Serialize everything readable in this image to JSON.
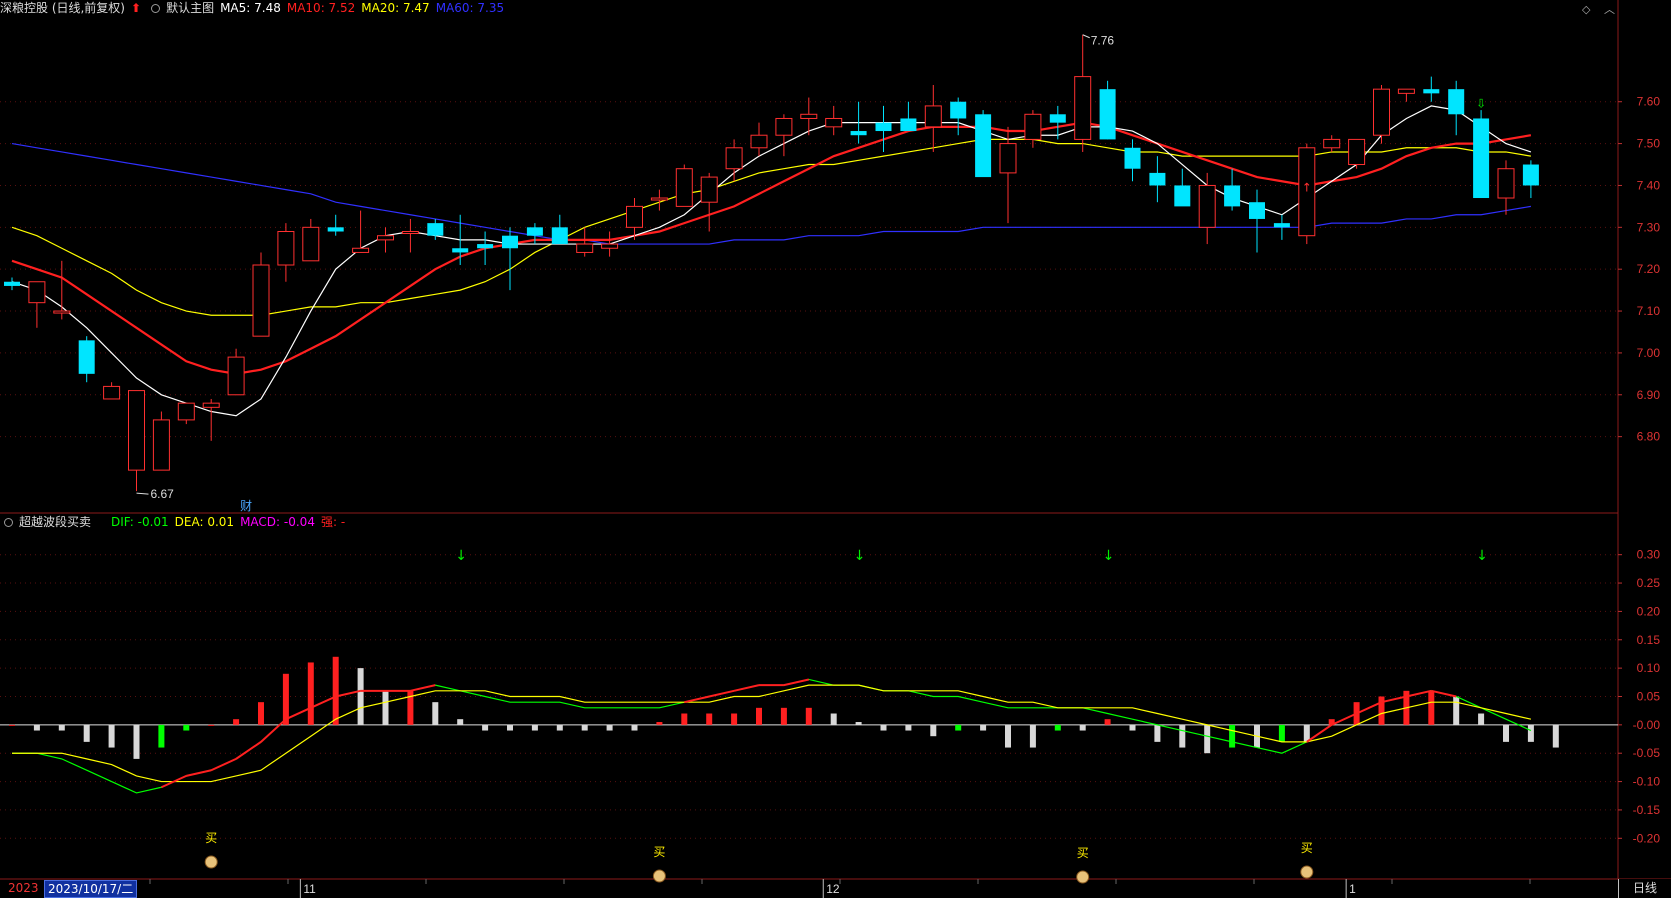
{
  "header": {
    "stock_title": "深粮控股 (日线,前复权)",
    "main_chart_label": "默认主图",
    "ma5": "MA5: 7.48",
    "ma10": "MA10: 7.52",
    "ma20": "MA20: 7.47",
    "ma60": "MA60: 7.35",
    "colors": {
      "ma5": "#ffffff",
      "ma10": "#ff2020",
      "ma20": "#ffff00",
      "ma60": "#3030ff"
    }
  },
  "indicator_header": {
    "name": "超越波段买卖",
    "dif": "DIF: -0.01",
    "dea": "DEA: 0.01",
    "macd": "MACD: -0.04",
    "extra": "强: -",
    "colors": {
      "dif": "#00ff00",
      "dea": "#ffff00",
      "macd": "#ff00ff",
      "extra": "#ff2020"
    }
  },
  "annotations": {
    "high_label": "7.76",
    "low_label": "6.67",
    "finance_marker": "财",
    "buy_label": "买"
  },
  "axis": {
    "price_ticks": [
      "7.60",
      "7.50",
      "7.40",
      "7.30",
      "7.20",
      "7.10",
      "7.00",
      "6.90",
      "6.80"
    ],
    "macd_ticks": [
      "0.30",
      "0.25",
      "0.20",
      "0.15",
      "0.10",
      "0.05",
      "-0.00",
      "-0.05",
      "-0.10",
      "-0.15",
      "-0.20"
    ],
    "month_labels": [
      "11",
      "12",
      "1"
    ]
  },
  "status": {
    "year_prefix": "2023",
    "cursor_date": "2023/10/17/二",
    "period_label": "日线"
  },
  "chart_data": {
    "type": "candlestick",
    "price_range": [
      6.62,
      7.8
    ],
    "macd_range": [
      -0.27,
      0.34
    ],
    "candles": [
      [
        7.17,
        7.18,
        7.15,
        7.16
      ],
      [
        7.12,
        7.17,
        7.06,
        7.17
      ],
      [
        7.1,
        7.22,
        7.08,
        7.1
      ],
      [
        7.03,
        7.04,
        6.93,
        6.95
      ],
      [
        6.89,
        6.93,
        6.89,
        6.92
      ],
      [
        6.72,
        6.91,
        6.67,
        6.91
      ],
      [
        6.72,
        6.86,
        6.72,
        6.84
      ],
      [
        6.84,
        6.87,
        6.83,
        6.88
      ],
      [
        6.87,
        6.89,
        6.79,
        6.88
      ],
      [
        6.9,
        7.01,
        6.9,
        6.99
      ],
      [
        7.04,
        7.24,
        7.04,
        7.21
      ],
      [
        7.21,
        7.31,
        7.17,
        7.29
      ],
      [
        7.22,
        7.32,
        7.22,
        7.3
      ],
      [
        7.3,
        7.33,
        7.28,
        7.29
      ],
      [
        7.24,
        7.34,
        7.24,
        7.25
      ],
      [
        7.27,
        7.3,
        7.24,
        7.28
      ],
      [
        7.29,
        7.32,
        7.24,
        7.29
      ],
      [
        7.31,
        7.32,
        7.27,
        7.28
      ],
      [
        7.25,
        7.33,
        7.21,
        7.24
      ],
      [
        7.26,
        7.29,
        7.21,
        7.25
      ],
      [
        7.28,
        7.3,
        7.15,
        7.25
      ],
      [
        7.3,
        7.31,
        7.26,
        7.28
      ],
      [
        7.3,
        7.33,
        7.28,
        7.26
      ],
      [
        7.24,
        7.3,
        7.23,
        7.26
      ],
      [
        7.25,
        7.29,
        7.23,
        7.26
      ],
      [
        7.3,
        7.37,
        7.27,
        7.35
      ],
      [
        7.37,
        7.39,
        7.34,
        7.37
      ],
      [
        7.35,
        7.45,
        7.35,
        7.44
      ],
      [
        7.36,
        7.43,
        7.29,
        7.42
      ],
      [
        7.44,
        7.51,
        7.41,
        7.49
      ],
      [
        7.49,
        7.55,
        7.47,
        7.52
      ],
      [
        7.52,
        7.57,
        7.47,
        7.56
      ],
      [
        7.56,
        7.61,
        7.52,
        7.57
      ],
      [
        7.54,
        7.59,
        7.52,
        7.56
      ],
      [
        7.53,
        7.6,
        7.5,
        7.52
      ],
      [
        7.55,
        7.59,
        7.48,
        7.53
      ],
      [
        7.56,
        7.6,
        7.53,
        7.53
      ],
      [
        7.54,
        7.64,
        7.48,
        7.59
      ],
      [
        7.6,
        7.61,
        7.52,
        7.56
      ],
      [
        7.57,
        7.58,
        7.43,
        7.42
      ],
      [
        7.43,
        7.54,
        7.31,
        7.5
      ],
      [
        7.51,
        7.58,
        7.49,
        7.57
      ],
      [
        7.57,
        7.59,
        7.51,
        7.55
      ],
      [
        7.51,
        7.76,
        7.48,
        7.66
      ],
      [
        7.63,
        7.65,
        7.51,
        7.51
      ],
      [
        7.49,
        7.51,
        7.41,
        7.44
      ],
      [
        7.43,
        7.47,
        7.36,
        7.4
      ],
      [
        7.4,
        7.44,
        7.38,
        7.35
      ],
      [
        7.3,
        7.43,
        7.26,
        7.4
      ],
      [
        7.4,
        7.44,
        7.34,
        7.35
      ],
      [
        7.36,
        7.39,
        7.24,
        7.32
      ],
      [
        7.31,
        7.33,
        7.27,
        7.3
      ],
      [
        7.28,
        7.5,
        7.26,
        7.49
      ],
      [
        7.49,
        7.52,
        7.48,
        7.51
      ],
      [
        7.45,
        7.51,
        7.44,
        7.51
      ],
      [
        7.52,
        7.64,
        7.5,
        7.63
      ],
      [
        7.62,
        7.63,
        7.6,
        7.63
      ],
      [
        7.63,
        7.66,
        7.6,
        7.62
      ],
      [
        7.63,
        7.65,
        7.52,
        7.57
      ],
      [
        7.56,
        7.58,
        7.37,
        7.37
      ],
      [
        7.37,
        7.46,
        7.33,
        7.44
      ],
      [
        7.45,
        7.46,
        7.37,
        7.4
      ]
    ],
    "ma5": [
      7.17,
      7.15,
      7.11,
      7.06,
      7.0,
      6.94,
      6.9,
      6.88,
      6.86,
      6.85,
      6.89,
      6.99,
      7.1,
      7.2,
      7.25,
      7.28,
      7.29,
      7.28,
      7.27,
      7.27,
      7.26,
      7.26,
      7.26,
      7.26,
      7.26,
      7.28,
      7.3,
      7.33,
      7.38,
      7.43,
      7.47,
      7.5,
      7.53,
      7.55,
      7.55,
      7.55,
      7.55,
      7.55,
      7.55,
      7.53,
      7.51,
      7.52,
      7.52,
      7.54,
      7.54,
      7.53,
      7.5,
      7.45,
      7.4,
      7.37,
      7.35,
      7.33,
      7.37,
      7.41,
      7.45,
      7.52,
      7.56,
      7.59,
      7.58,
      7.54,
      7.5,
      7.48
    ],
    "ma10": [
      7.22,
      7.2,
      7.18,
      7.14,
      7.1,
      7.06,
      7.02,
      6.98,
      6.96,
      6.95,
      6.96,
      6.98,
      7.01,
      7.04,
      7.08,
      7.12,
      7.16,
      7.2,
      7.23,
      7.25,
      7.26,
      7.27,
      7.27,
      7.27,
      7.27,
      7.28,
      7.29,
      7.31,
      7.33,
      7.35,
      7.38,
      7.41,
      7.44,
      7.47,
      7.49,
      7.51,
      7.53,
      7.54,
      7.54,
      7.54,
      7.53,
      7.53,
      7.54,
      7.55,
      7.54,
      7.52,
      7.5,
      7.48,
      7.46,
      7.44,
      7.42,
      7.41,
      7.4,
      7.41,
      7.42,
      7.44,
      7.47,
      7.49,
      7.5,
      7.5,
      7.51,
      7.52
    ],
    "ma20": [
      7.3,
      7.28,
      7.25,
      7.22,
      7.19,
      7.15,
      7.12,
      7.1,
      7.09,
      7.09,
      7.09,
      7.1,
      7.11,
      7.11,
      7.12,
      7.12,
      7.13,
      7.14,
      7.15,
      7.17,
      7.2,
      7.24,
      7.27,
      7.3,
      7.32,
      7.34,
      7.36,
      7.38,
      7.39,
      7.41,
      7.43,
      7.44,
      7.45,
      7.45,
      7.46,
      7.47,
      7.48,
      7.49,
      7.5,
      7.51,
      7.51,
      7.51,
      7.5,
      7.5,
      7.49,
      7.48,
      7.48,
      7.47,
      7.47,
      7.47,
      7.47,
      7.47,
      7.47,
      7.48,
      7.48,
      7.48,
      7.49,
      7.49,
      7.49,
      7.48,
      7.48,
      7.47
    ],
    "ma60": [
      7.5,
      7.49,
      7.48,
      7.47,
      7.46,
      7.45,
      7.44,
      7.43,
      7.42,
      7.41,
      7.4,
      7.39,
      7.38,
      7.36,
      7.35,
      7.34,
      7.33,
      7.32,
      7.31,
      7.3,
      7.29,
      7.28,
      7.27,
      7.27,
      7.26,
      7.26,
      7.26,
      7.26,
      7.26,
      7.27,
      7.27,
      7.27,
      7.28,
      7.28,
      7.28,
      7.29,
      7.29,
      7.29,
      7.29,
      7.3,
      7.3,
      7.3,
      7.3,
      7.3,
      7.3,
      7.3,
      7.3,
      7.3,
      7.3,
      7.3,
      7.3,
      7.3,
      7.3,
      7.31,
      7.31,
      7.31,
      7.32,
      7.32,
      7.33,
      7.33,
      7.34,
      7.35
    ],
    "macd_hist": [
      0,
      -0.01,
      -0.01,
      -0.03,
      -0.04,
      -0.06,
      -0.04,
      -0.01,
      0,
      0.01,
      0.04,
      0.09,
      0.11,
      0.12,
      0.1,
      0.06,
      0.06,
      0.04,
      0.01,
      -0.01,
      -0.01,
      -0.01,
      -0.01,
      -0.01,
      -0.01,
      -0.01,
      0.005,
      0.02,
      0.02,
      0.02,
      0.03,
      0.03,
      0.03,
      0.02,
      0.005,
      -0.01,
      -0.01,
      -0.02,
      -0.01,
      -0.01,
      -0.04,
      -0.04,
      -0.01,
      -0.01,
      0.01,
      -0.01,
      -0.03,
      -0.04,
      -0.05,
      -0.04,
      -0.04,
      -0.03,
      -0.03,
      0.01,
      0.04,
      0.05,
      0.06,
      0.06,
      0.05,
      0.02,
      -0.03,
      -0.03,
      -0.04
    ],
    "dif": [
      -0.05,
      -0.05,
      -0.06,
      -0.08,
      -0.1,
      -0.12,
      -0.11,
      -0.09,
      -0.08,
      -0.06,
      -0.03,
      0.01,
      0.03,
      0.05,
      0.06,
      0.06,
      0.06,
      0.07,
      0.06,
      0.05,
      0.04,
      0.04,
      0.04,
      0.03,
      0.03,
      0.03,
      0.03,
      0.04,
      0.05,
      0.06,
      0.07,
      0.07,
      0.08,
      0.07,
      0.07,
      0.06,
      0.06,
      0.05,
      0.05,
      0.04,
      0.03,
      0.03,
      0.03,
      0.03,
      0.02,
      0.01,
      0.0,
      -0.01,
      -0.02,
      -0.03,
      -0.04,
      -0.05,
      -0.03,
      0.0,
      0.02,
      0.04,
      0.05,
      0.06,
      0.05,
      0.03,
      0.01,
      -0.01
    ],
    "dea": [
      -0.05,
      -0.05,
      -0.05,
      -0.06,
      -0.07,
      -0.09,
      -0.1,
      -0.1,
      -0.1,
      -0.09,
      -0.08,
      -0.05,
      -0.02,
      0.01,
      0.03,
      0.04,
      0.05,
      0.06,
      0.06,
      0.06,
      0.05,
      0.05,
      0.05,
      0.04,
      0.04,
      0.04,
      0.04,
      0.04,
      0.04,
      0.05,
      0.05,
      0.06,
      0.07,
      0.07,
      0.07,
      0.06,
      0.06,
      0.06,
      0.06,
      0.05,
      0.04,
      0.04,
      0.03,
      0.03,
      0.03,
      0.03,
      0.02,
      0.01,
      0.0,
      -0.01,
      -0.02,
      -0.03,
      -0.03,
      -0.02,
      0.0,
      0.02,
      0.03,
      0.04,
      0.04,
      0.03,
      0.02,
      0.01
    ],
    "sell_signals_at": [
      18,
      34,
      44,
      59
    ],
    "buy_signals_at": [
      8,
      26,
      43,
      52
    ]
  }
}
